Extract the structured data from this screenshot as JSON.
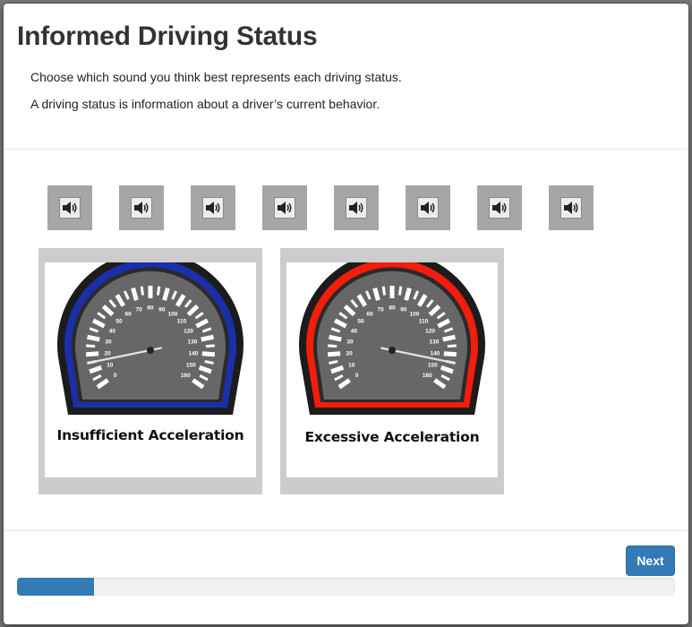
{
  "header": {
    "title": "Informed Driving Status",
    "instruction_1": "Choose which sound you think best represents each driving status.",
    "instruction_2": "A driving status is information about a driver’s current behavior."
  },
  "sounds": {
    "icon": "speaker-icon",
    "count": 8
  },
  "cards": [
    {
      "label": "Insufficient Acceleration",
      "ring_color": "#1a2fa8",
      "needle_speed": 15,
      "tick_labels": [
        "0",
        "10",
        "20",
        "30",
        "40",
        "50",
        "60",
        "70",
        "80",
        "90",
        "100",
        "110",
        "120",
        "130",
        "140",
        "150",
        "160"
      ]
    },
    {
      "label": "Excessive Acceleration",
      "ring_color": "#f21d0c",
      "needle_speed": 145,
      "tick_labels": [
        "0",
        "10",
        "20",
        "30",
        "40",
        "50",
        "60",
        "70",
        "80",
        "90",
        "100",
        "110",
        "120",
        "130",
        "140",
        "150",
        "160"
      ]
    }
  ],
  "footer": {
    "next_label": "Next",
    "progress_fraction": 0.117
  },
  "colors": {
    "accent": "#337ab7",
    "sound_button_bg": "#a6a6a6",
    "card_bg": "#cccccc"
  }
}
